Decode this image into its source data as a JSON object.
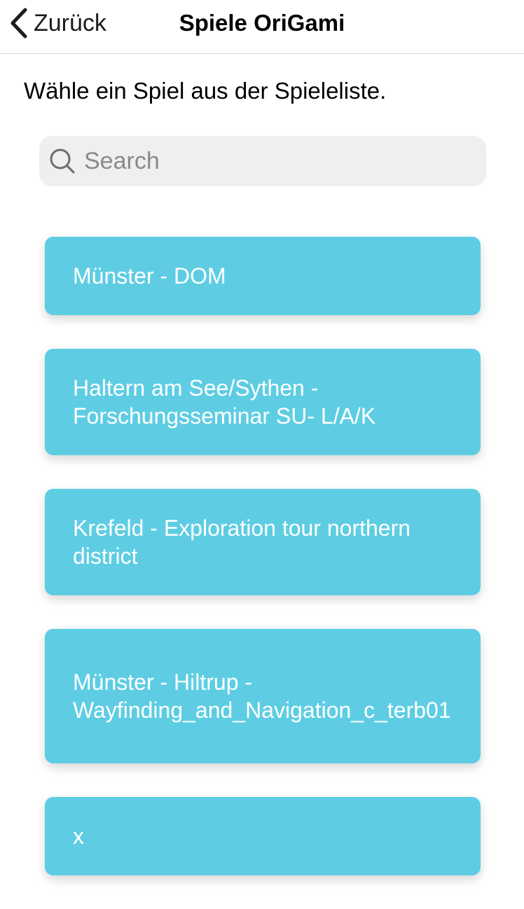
{
  "nav": {
    "back_label": "Zurück",
    "title": "Spiele OriGami"
  },
  "instruction": "Wähle ein Spiel aus der Spieleliste.",
  "search": {
    "placeholder": "Search",
    "value": ""
  },
  "games": [
    {
      "label": "Münster - DOM"
    },
    {
      "label": "Haltern am See/Sythen - Forschungsseminar SU- L/A/K"
    },
    {
      "label": "Krefeld - Exploration tour northern district"
    },
    {
      "label": "Münster - Hiltrup - Wayfinding_and_Navigation_c_terb01"
    },
    {
      "label": "x"
    }
  ],
  "colors": {
    "card_background": "#5ecde3",
    "card_text": "#ffffff",
    "search_background": "#efeff0"
  },
  "icons": {
    "back": "chevron-left-icon",
    "search": "search-icon"
  }
}
